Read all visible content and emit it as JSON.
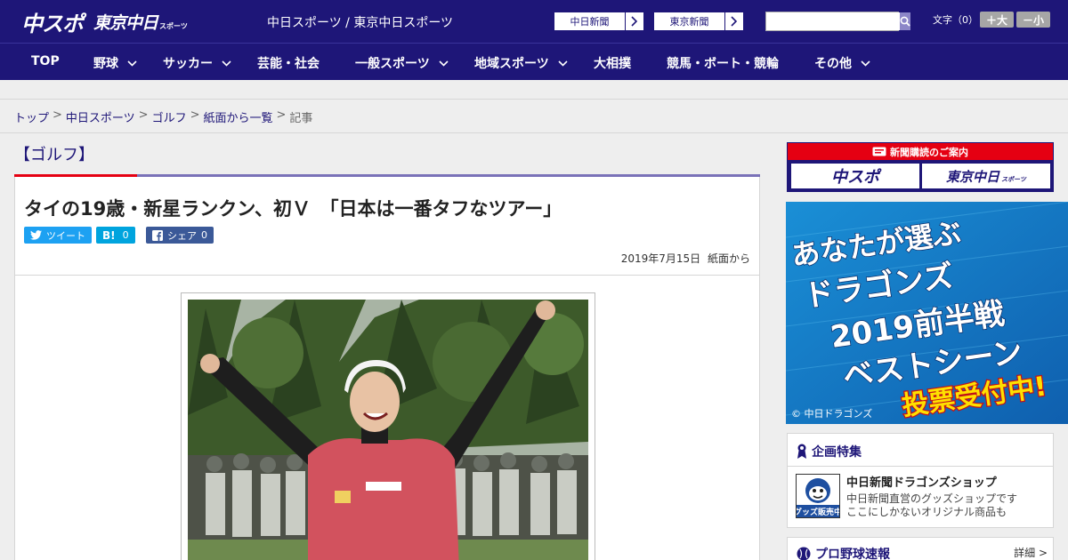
{
  "header": {
    "logo_main": "中スポ",
    "logo_tokyo": "東京中日",
    "logo_small": "スポーツ",
    "site_title": "中日スポーツ / 東京中日スポーツ",
    "links": [
      {
        "label": "中日新聞"
      },
      {
        "label": "東京新聞"
      }
    ],
    "search_placeholder": "",
    "font_size_label": "文字（0）",
    "font_bigger": "＋大",
    "font_smaller": "－小"
  },
  "nav": {
    "items": [
      {
        "label": "TOP"
      },
      {
        "label": "野球"
      },
      {
        "label": "サッカー"
      },
      {
        "label": "芸能・社会"
      },
      {
        "label": "一般スポーツ"
      },
      {
        "label": "地域スポーツ"
      },
      {
        "label": "大相撲"
      },
      {
        "label": "競馬・ボート・競輪"
      },
      {
        "label": "その他"
      }
    ]
  },
  "breadcrumb": {
    "items": [
      "トップ",
      "中日スポーツ",
      "ゴルフ",
      "紙面から一覧"
    ],
    "current": "記事",
    "separator": ">"
  },
  "category": "【ゴルフ】",
  "article": {
    "headline": "タイの19歳・新星ランクン、初Ｖ　「日本は一番タフなツアー」",
    "tweet_label": "ツイート",
    "hatena_label": "B!",
    "hatena_count": "0",
    "fb_label": "シェア",
    "fb_count": "0",
    "date": "2019年7月15日",
    "source": "紙面から"
  },
  "sidebar": {
    "subscribe_header": "新聞購読のご案内",
    "subscribe_buttons": [
      {
        "label": "中スポ"
      },
      {
        "label": "東京中日"
      }
    ],
    "subscribe_small": "スポーツ",
    "banner_lines": [
      "あなたが選ぶ",
      "ドラゴンズ",
      "2019前半戦",
      "ベストシーン",
      "投票受付中!"
    ],
    "banner_copyright": "© 中日ドラゴンズ",
    "feature_title": "企画特集",
    "feature_name": "中日新聞ドラゴンズショップ",
    "feature_desc_1": "中日新聞直営のグッズショップです",
    "feature_desc_2": "ここにしかないオリジナル商品も",
    "feature_thumb_text": "グッズ販売中",
    "baseball_title": "プロ野球速報",
    "baseball_more": "詳細 >"
  },
  "colors": {
    "brand_navy": "#1e1678",
    "accent_red": "#e50012",
    "twitter_blue": "#1da1f2",
    "hatena_blue": "#00a4de",
    "facebook_blue": "#3b5998"
  }
}
